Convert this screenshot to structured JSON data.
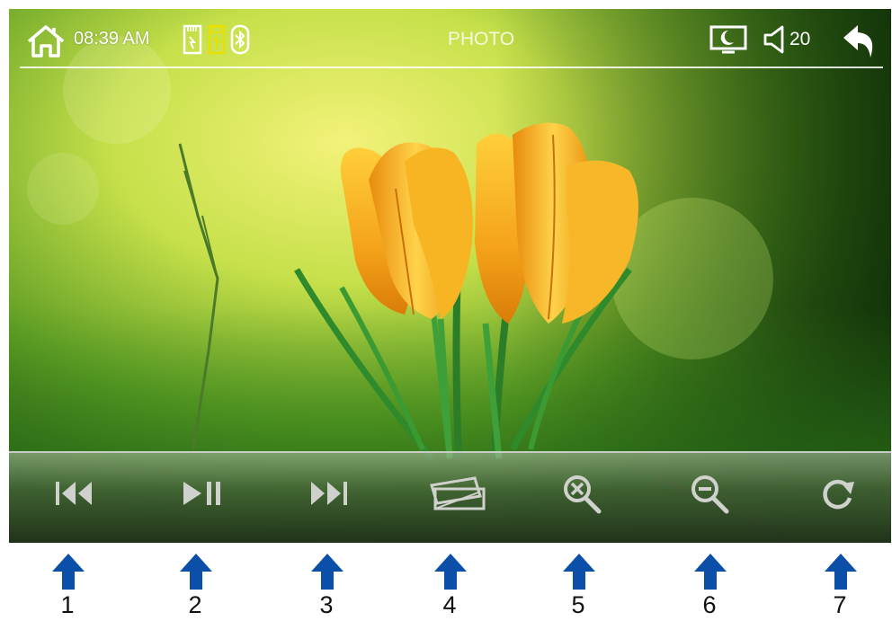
{
  "status_bar": {
    "time": "08:39 AM",
    "title": "PHOTO",
    "volume": "20"
  },
  "icons": {
    "home": "home-icon",
    "sd_card": "sd-card-icon",
    "usb": "usb-icon",
    "bluetooth": "bluetooth-icon",
    "display_mode": "display-night-icon",
    "speaker": "speaker-icon",
    "back": "back-arrow-icon"
  },
  "controls": [
    {
      "id": "previous",
      "icon": "skip-previous-icon"
    },
    {
      "id": "play_pause",
      "icon": "play-pause-icon"
    },
    {
      "id": "next",
      "icon": "skip-next-icon"
    },
    {
      "id": "slideshow",
      "icon": "slideshow-icon"
    },
    {
      "id": "zoom_in",
      "icon": "zoom-in-icon"
    },
    {
      "id": "zoom_out",
      "icon": "zoom-out-icon"
    },
    {
      "id": "rotate",
      "icon": "rotate-icon"
    }
  ],
  "callouts": [
    "1",
    "2",
    "3",
    "4",
    "5",
    "6",
    "7"
  ],
  "colors": {
    "callout_arrow": "#0b4fa8",
    "usb_active": "#e8e000",
    "flower": "#f5a31a"
  }
}
